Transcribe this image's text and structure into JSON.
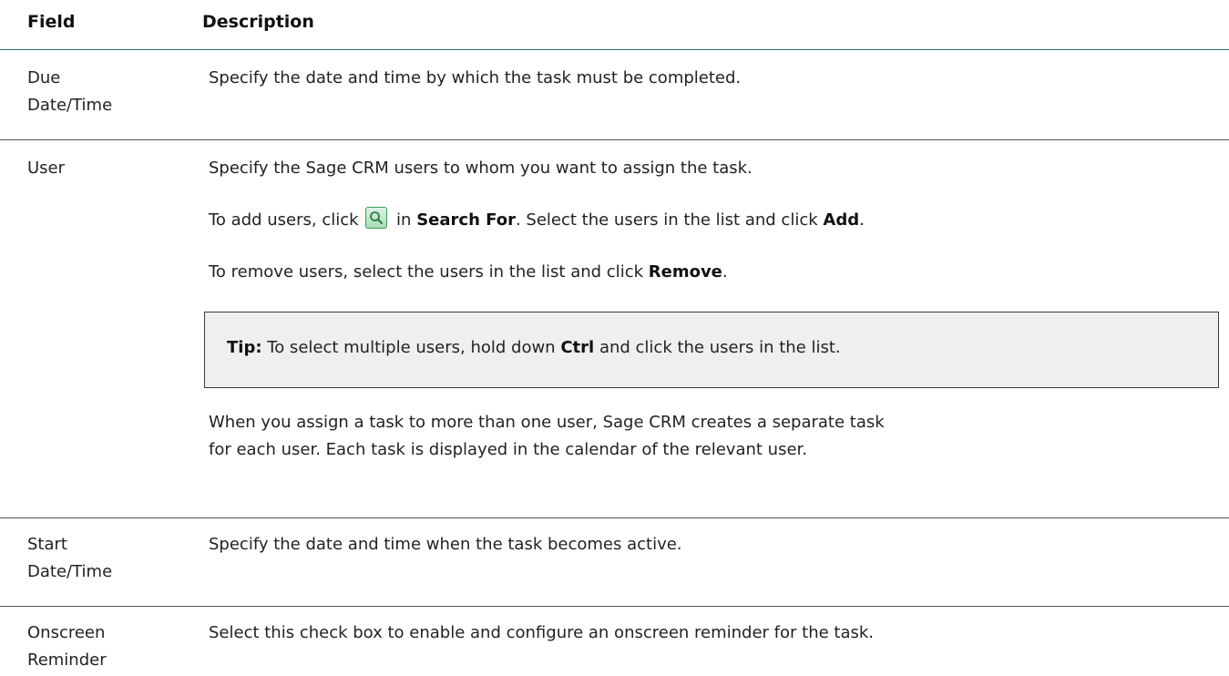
{
  "header": {
    "field": "Field",
    "description": "Description"
  },
  "rows": [
    {
      "field_lines": [
        "Due",
        "Date/Time"
      ],
      "desc": "Specify the date and time by which the task must be completed."
    },
    {
      "field_lines": [
        "User"
      ],
      "p1": "Specify the Sage CRM users to whom you want to assign the task.",
      "p2": {
        "a": "To add users, click",
        "b": "in",
        "c": "Search For",
        "d": ". Select the users in the list and click",
        "e": "Add",
        "f": "."
      },
      "p3": {
        "a": "To remove users, select the users in the list and click",
        "b": "Remove",
        "c": "."
      },
      "tip": {
        "label": "Tip:",
        "a": "To select multiple users, hold down",
        "b": "Ctrl",
        "c": "and click the users in the list."
      },
      "p4_line1": "When you assign a task to more than one user, Sage CRM creates a separate task",
      "p4_line2": "for each user. Each task is displayed in the calendar of the relevant user."
    },
    {
      "field_lines": [
        "Start",
        "Date/Time"
      ],
      "desc": "Specify the date and time when the task becomes active."
    },
    {
      "field_lines": [
        "Onscreen",
        "Reminder"
      ],
      "desc": "Select this check box to enable and configure an onscreen reminder for the task."
    }
  ],
  "icons": {
    "search_icon": "search-icon",
    "search_icon_color": "#3b9d5a"
  },
  "colors": {
    "header_rule": "#2a6f78",
    "tip_background": "#efefef"
  }
}
